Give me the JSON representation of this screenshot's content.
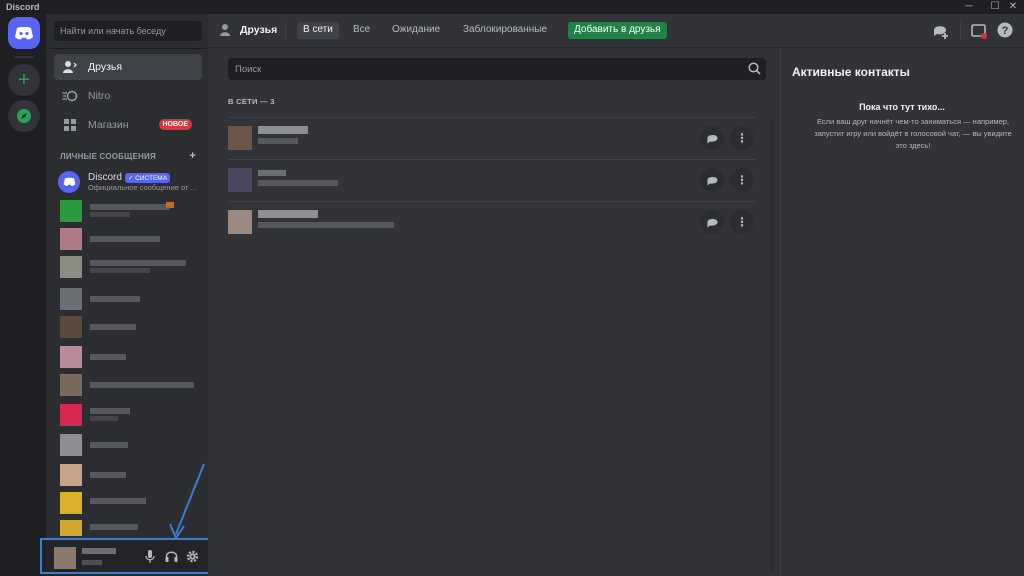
{
  "window": {
    "title": "Discord",
    "controls": [
      "─",
      "☐",
      "✕"
    ]
  },
  "sidebar": {
    "search_placeholder": "Найти или начать беседу",
    "nav": [
      {
        "label": "Друзья",
        "icon": "friends-icon",
        "active": true
      },
      {
        "label": "Nitro",
        "icon": "nitro-icon"
      },
      {
        "label": "Магазин",
        "icon": "shop-icon",
        "badge": "НОВОЕ"
      }
    ],
    "dm_header": "ЛИЧНЫЕ СООБЩЕНИЯ",
    "dm_add": "+",
    "system_dm": {
      "name": "Discord",
      "badge": "✓ СИСТЕМА",
      "subtitle": "Официальное сообщение от ..."
    }
  },
  "header": {
    "title": "Друзья",
    "tabs": [
      "В сети",
      "Все",
      "Ожидание",
      "Заблокированные"
    ],
    "selected_tab": "В сети",
    "add_friend": "Добавить в друзья"
  },
  "friends": {
    "search_placeholder": "Поиск",
    "online_header": "В СЕТИ — 3"
  },
  "active_now": {
    "title": "Активные контакты",
    "empty_title": "Пока что тут тихо...",
    "empty_text": "Если ваш друг начнёт чем-то заниматься — например, запустит игру или войдёт в голосовой чат, — вы увидите это здесь!"
  },
  "colors": {
    "blurple": "#5865f2",
    "green": "#248046",
    "red_badge": "#da373c",
    "annotation": "#3a7bd5"
  }
}
